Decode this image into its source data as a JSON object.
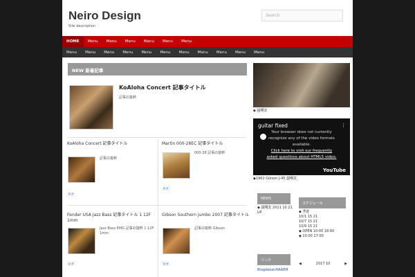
{
  "site": {
    "title": "Neiro Design",
    "description": "Site description"
  },
  "search": {
    "placeholder": "Search"
  },
  "nav_primary": [
    "HOME",
    "Menu",
    "Menu",
    "Menu",
    "Menu",
    "Menu",
    "Menu"
  ],
  "nav_secondary": [
    "Menu",
    "Menu",
    "Menu",
    "Menu",
    "Menu",
    "Menu",
    "Menu",
    "Menu",
    "Menu",
    "Menu",
    "Menu"
  ],
  "main": {
    "new_label": "NEW 新着記事",
    "featured": {
      "title": "KoAloha Concert 記事タイトル",
      "text": "記事の抜粋"
    },
    "cards": [
      {
        "title": "KoAloha Concert 記事タイトル",
        "text": "記事の抜粋",
        "tags": "タグ"
      },
      {
        "title": "Martin 000-28EC 記事タイトル",
        "text": "000-28 記事の抜粋",
        "tags": "タグ"
      },
      {
        "title": "Fender USA Jazz Bass 記事タイトル 1 12F 1mm",
        "text": "Jazz Bass EMG 記事の抜粋 1 12F 1mm",
        "tags": "タグ"
      },
      {
        "title": "Gibson Southern Jumbo 2007 記事タイトル",
        "text": "記事の抜粋 Gibson",
        "tags": "タグ"
      }
    ]
  },
  "sidebar": {
    "photo_caption": "◆ 説明文",
    "video": {
      "title": "guitar fixed",
      "message_line1": "Your browser does not currently",
      "message_line2": "recognize any of the video formats",
      "message_line3": "available.",
      "link_line1": "Click here to visit our frequently",
      "link_line2": "asked questions about HTML5 video.",
      "brand": "YouTube"
    },
    "after_video_text": "◆1962 Gibson J-45 説明文",
    "news_header": "NEWS",
    "news_text": "◆ 説明文 2011 10 21 UP",
    "schedule_header": "スケジュール",
    "schedule_lines": [
      "◆ 予定",
      "10/1 15 21",
      "10/7 15 21",
      "10/9 15 21",
      "◆ OPEN 10:00 18:00",
      "◆ 10:00 17:00"
    ],
    "calendar_year": "2017 10",
    "blog_header": "リンク",
    "blog_link": "BlogdekanHAAEM"
  }
}
